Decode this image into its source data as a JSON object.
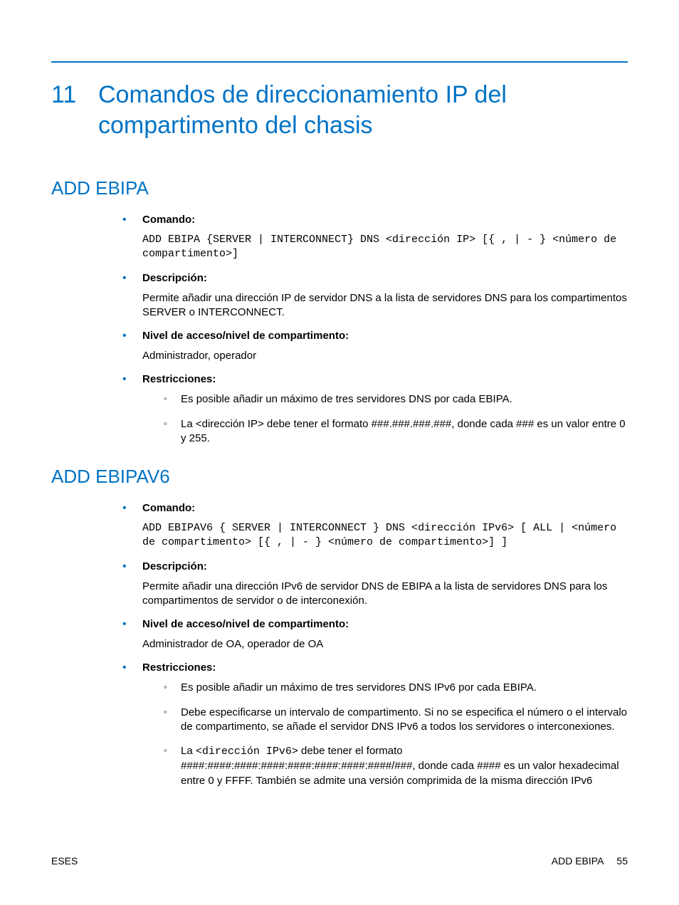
{
  "chapter": {
    "number": "11",
    "title": "Comandos de direccionamiento IP del compartimento del chasis"
  },
  "sections": [
    {
      "title": "ADD EBIPA",
      "comando_label": "Comando:",
      "comando_code": "ADD EBIPA {SERVER | INTERCONNECT} DNS <dirección IP> [{ , | - } <número de compartimento>]",
      "descripcion_label": "Descripción:",
      "descripcion_text": "Permite añadir una dirección IP de servidor DNS a la lista de servidores DNS para los compartimentos SERVER o INTERCONNECT.",
      "nivel_label": "Nivel de acceso/nivel de compartimento:",
      "nivel_text": "Administrador, operador",
      "restricciones_label": "Restricciones:",
      "restricciones": [
        "Es posible añadir un máximo de tres servidores DNS por cada EBIPA.",
        "La <dirección IP> debe tener el formato ###.###.###.###, donde cada ### es un valor entre 0 y 255."
      ]
    },
    {
      "title": "ADD EBIPAV6",
      "comando_label": "Comando:",
      "comando_code": "ADD EBIPAV6 { SERVER | INTERCONNECT } DNS <dirección IPv6> [ ALL | <número de compartimento> [{ , | - } <número de compartimento>] ]",
      "descripcion_label": "Descripción:",
      "descripcion_text": "Permite añadir una dirección IPv6 de servidor DNS de EBIPA a la lista de servidores DNS para los compartimentos de servidor o de interconexión.",
      "nivel_label": "Nivel de acceso/nivel de compartimento:",
      "nivel_text": "Administrador de OA, operador de OA",
      "restricciones_label": "Restricciones:",
      "restricciones": [
        "Es posible añadir un máximo de tres servidores DNS IPv6 por cada EBIPA.",
        "Debe especificarse un intervalo de compartimento. Si no se especifica el número o el intervalo de compartimento, se añade el servidor DNS IPv6 a todos los servidores o interconexiones."
      ],
      "restriccion_mixed": {
        "prefix": "La ",
        "code": "<dirección IPv6>",
        "suffix": " debe tener el formato ####:####:####:####:####:####:####:####/###, donde cada #### es un valor hexadecimal entre 0 y FFFF. También se admite una versión comprimida de la misma dirección IPv6"
      }
    }
  ],
  "footer": {
    "left": "ESES",
    "right_label": "ADD EBIPA",
    "page": "55"
  }
}
